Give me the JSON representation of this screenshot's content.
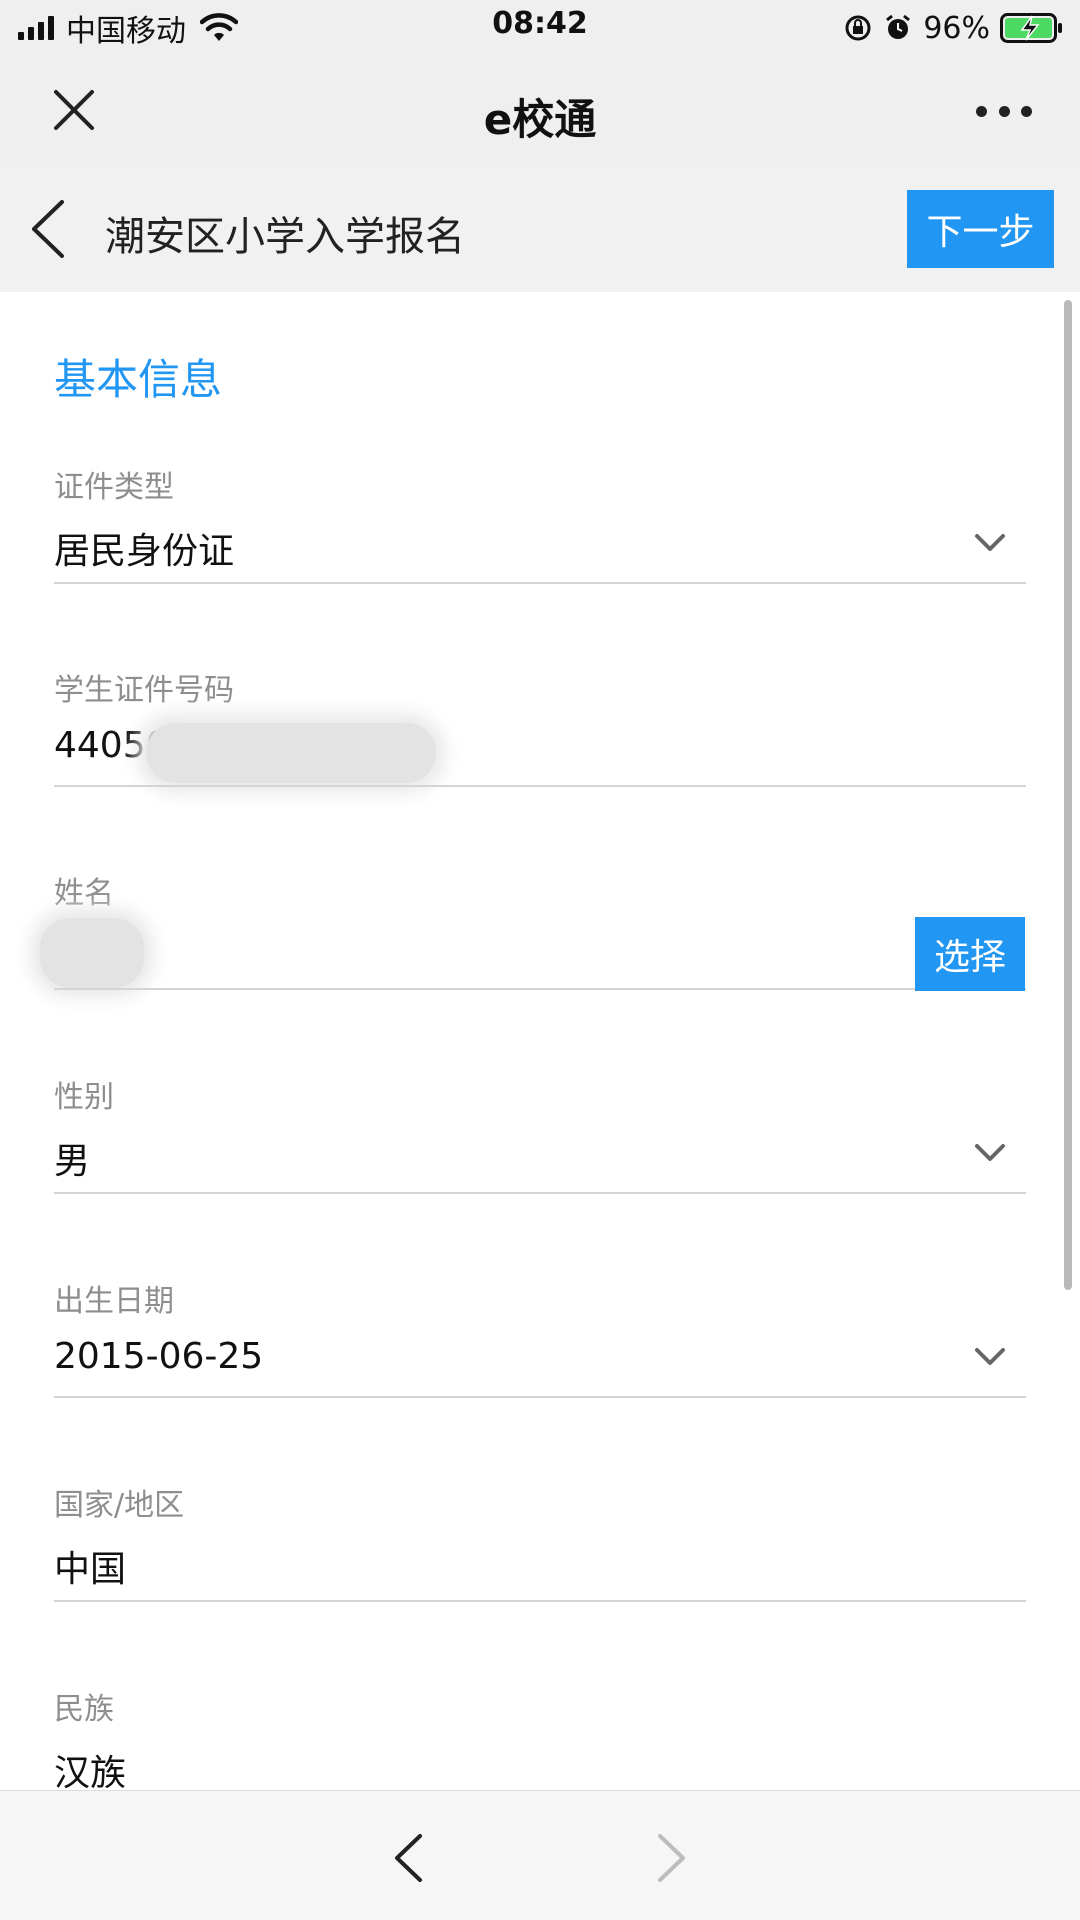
{
  "status_bar": {
    "carrier": "中国移动",
    "time": "08:42",
    "battery_percent": "96%",
    "icons": [
      "signal-icon",
      "wifi-icon",
      "orientation-lock-icon",
      "alarm-icon",
      "battery-charging-icon"
    ]
  },
  "title_bar": {
    "title": "e校通",
    "icons": [
      "close-icon",
      "more-icon"
    ]
  },
  "page_header": {
    "title": "潮安区小学入学报名",
    "next_label": "下一步",
    "icons": [
      "back-icon"
    ]
  },
  "form": {
    "section_title": "基本信息",
    "id_type": {
      "label": "证件类型",
      "value": "居民身份证"
    },
    "student_id": {
      "label": "学生证件号码",
      "value": "44050"
    },
    "name": {
      "label": "姓名",
      "value": "",
      "select_label": "选择"
    },
    "gender": {
      "label": "性别",
      "value": "男"
    },
    "birth_date": {
      "label": "出生日期",
      "value": "2015-06-25"
    },
    "country": {
      "label": "国家/地区",
      "value": "中国"
    },
    "ethnicity": {
      "label": "民族",
      "value": "汉族"
    }
  },
  "bottom_nav": {
    "icons": [
      "nav-back-icon",
      "nav-forward-icon"
    ]
  },
  "colors": {
    "accent": "#2196f3",
    "label": "#8e8e8e",
    "divider": "#d4d4d4",
    "battery": "#4cd964"
  }
}
